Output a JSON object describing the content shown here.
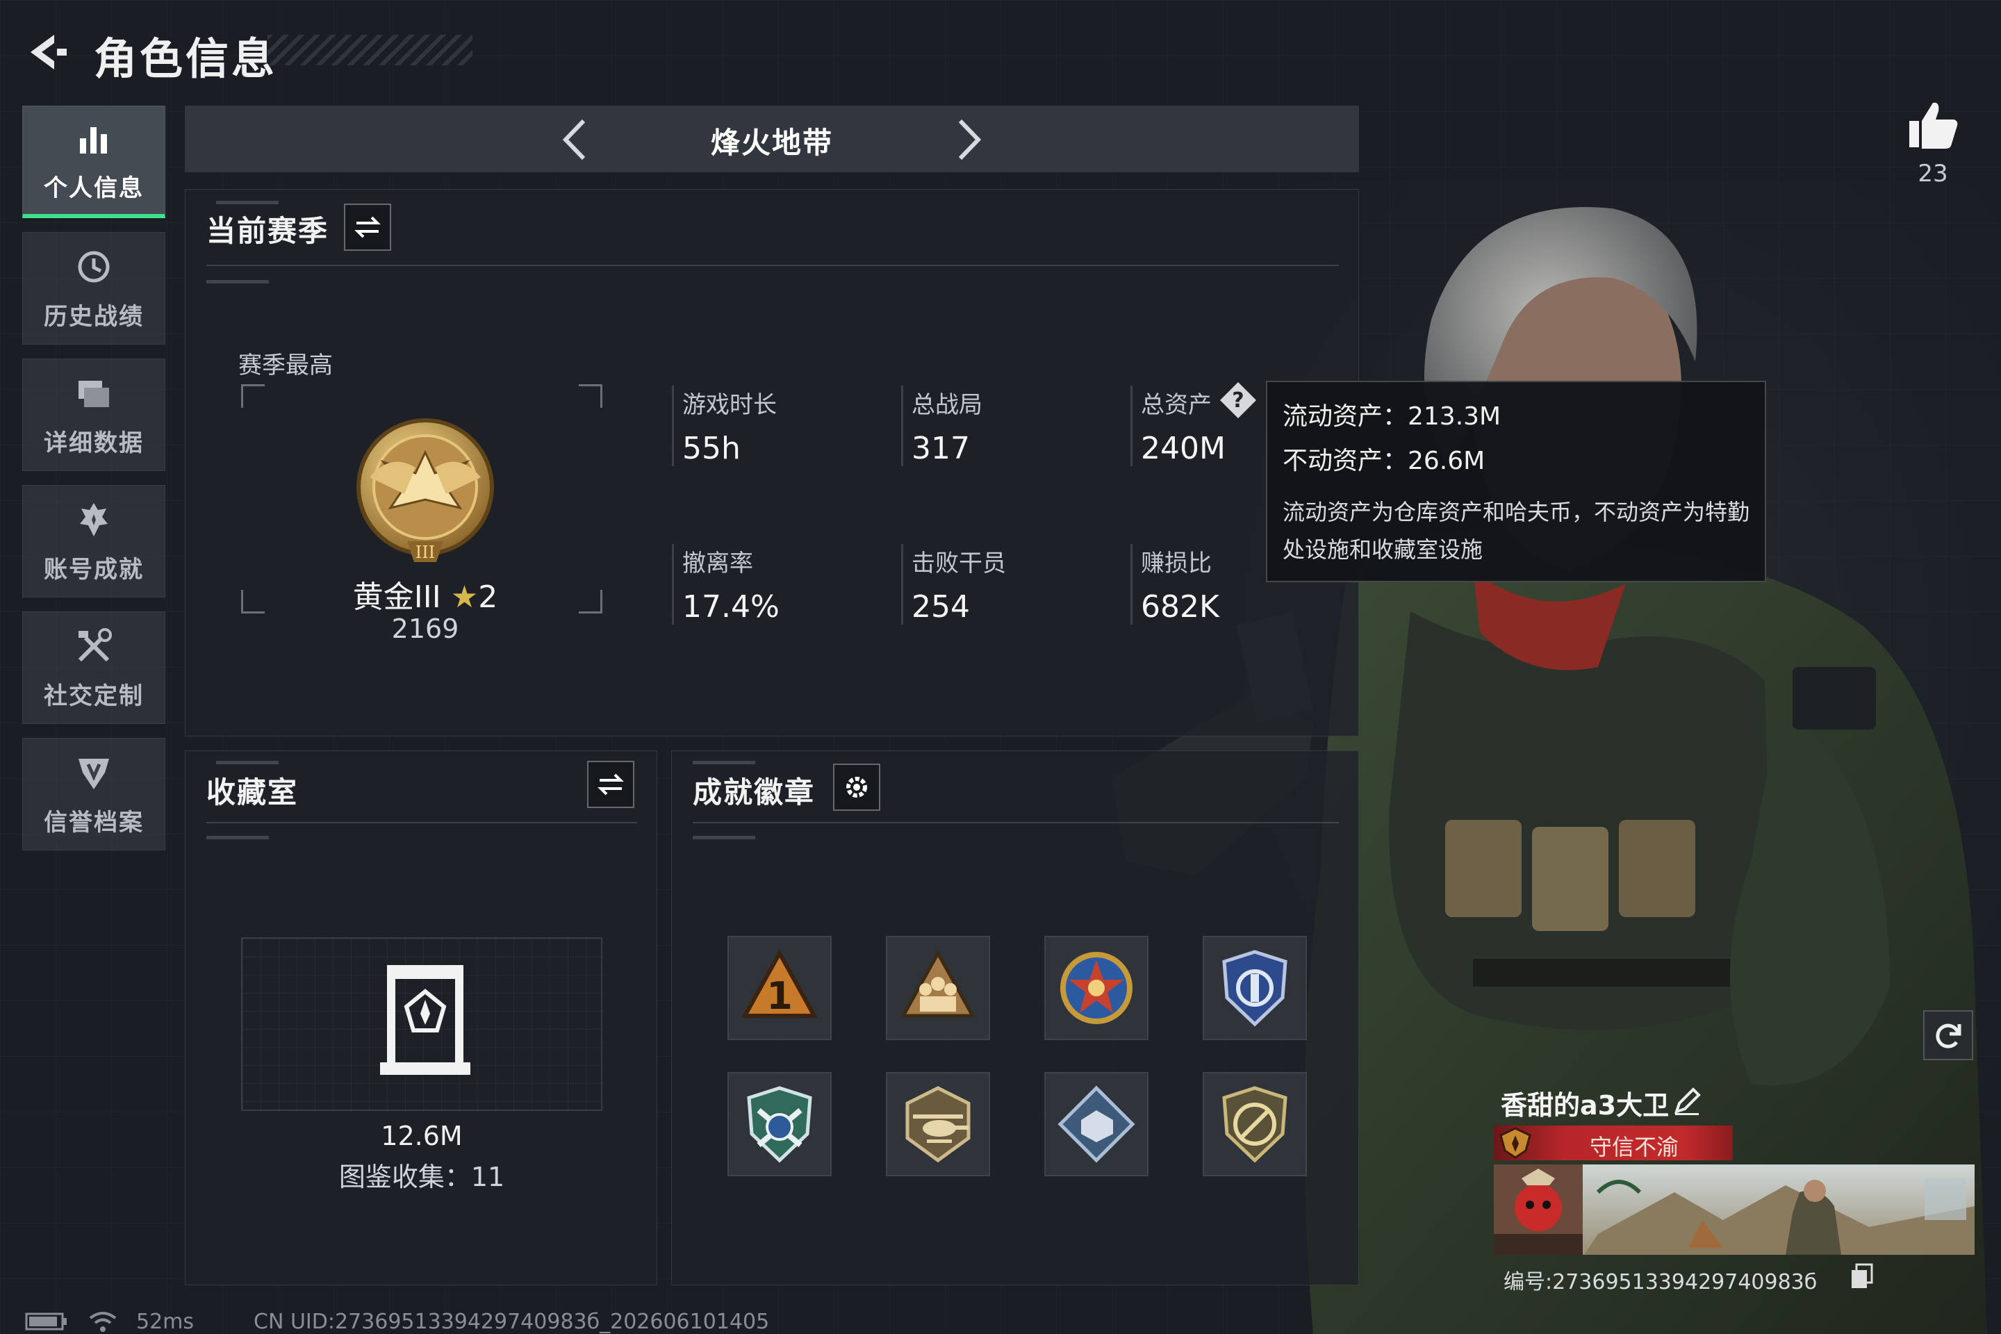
{
  "header": {
    "title": "角色信息"
  },
  "sidebar": {
    "items": [
      {
        "label": "个人信息",
        "icon": "bar-chart-icon",
        "active": true
      },
      {
        "label": "历史战绩",
        "icon": "history-icon",
        "active": false
      },
      {
        "label": "详细数据",
        "icon": "folder-icon",
        "active": false
      },
      {
        "label": "账号成就",
        "icon": "achievement-icon",
        "active": false
      },
      {
        "label": "社交定制",
        "icon": "tools-icon",
        "active": false
      },
      {
        "label": "信誉档案",
        "icon": "shield-icon",
        "active": false
      }
    ]
  },
  "mode_tab": {
    "title": "烽火地带"
  },
  "season": {
    "title": "当前赛季",
    "highest_label": "赛季最高",
    "rank": {
      "name": "黄金III",
      "stars": "2",
      "score": "2169"
    },
    "stats": [
      {
        "label": "游戏时长",
        "value": "55h"
      },
      {
        "label": "总战局",
        "value": "317"
      },
      {
        "label": "总资产",
        "value": "240M"
      },
      {
        "label": "撤离率",
        "value": "17.4%"
      },
      {
        "label": "击败干员",
        "value": "254"
      },
      {
        "label": "赚损比",
        "value": "682K"
      }
    ]
  },
  "tooltip": {
    "liquid": "流动资产：213.3M",
    "fixed": "不动资产：26.6M",
    "note": "流动资产为仓库资产和哈夫币，不动资产为特勤处设施和收藏室设施"
  },
  "collection": {
    "title": "收藏室",
    "value": "12.6M",
    "count": "图鉴收集：11"
  },
  "badges": {
    "title": "成就徽章",
    "items": [
      "badge-rank-1",
      "badge-squad",
      "badge-star-medal",
      "badge-police-shield",
      "badge-crossed-shield",
      "badge-helicopter",
      "badge-diamond-map",
      "badge-no-gun"
    ]
  },
  "likes": {
    "count": "23"
  },
  "player": {
    "name": "香甜的a3大卫",
    "title_badge": "守信不渝",
    "uid": "编号:2736951339429740983б"
  },
  "status_bar": {
    "ping": "52ms",
    "uid_line": "CN UID:2736951339429740983б_202606101405"
  },
  "colors": {
    "accent_green": "#3ee08a",
    "title_red": "#c02a2c",
    "gold": "#d8b64e"
  }
}
